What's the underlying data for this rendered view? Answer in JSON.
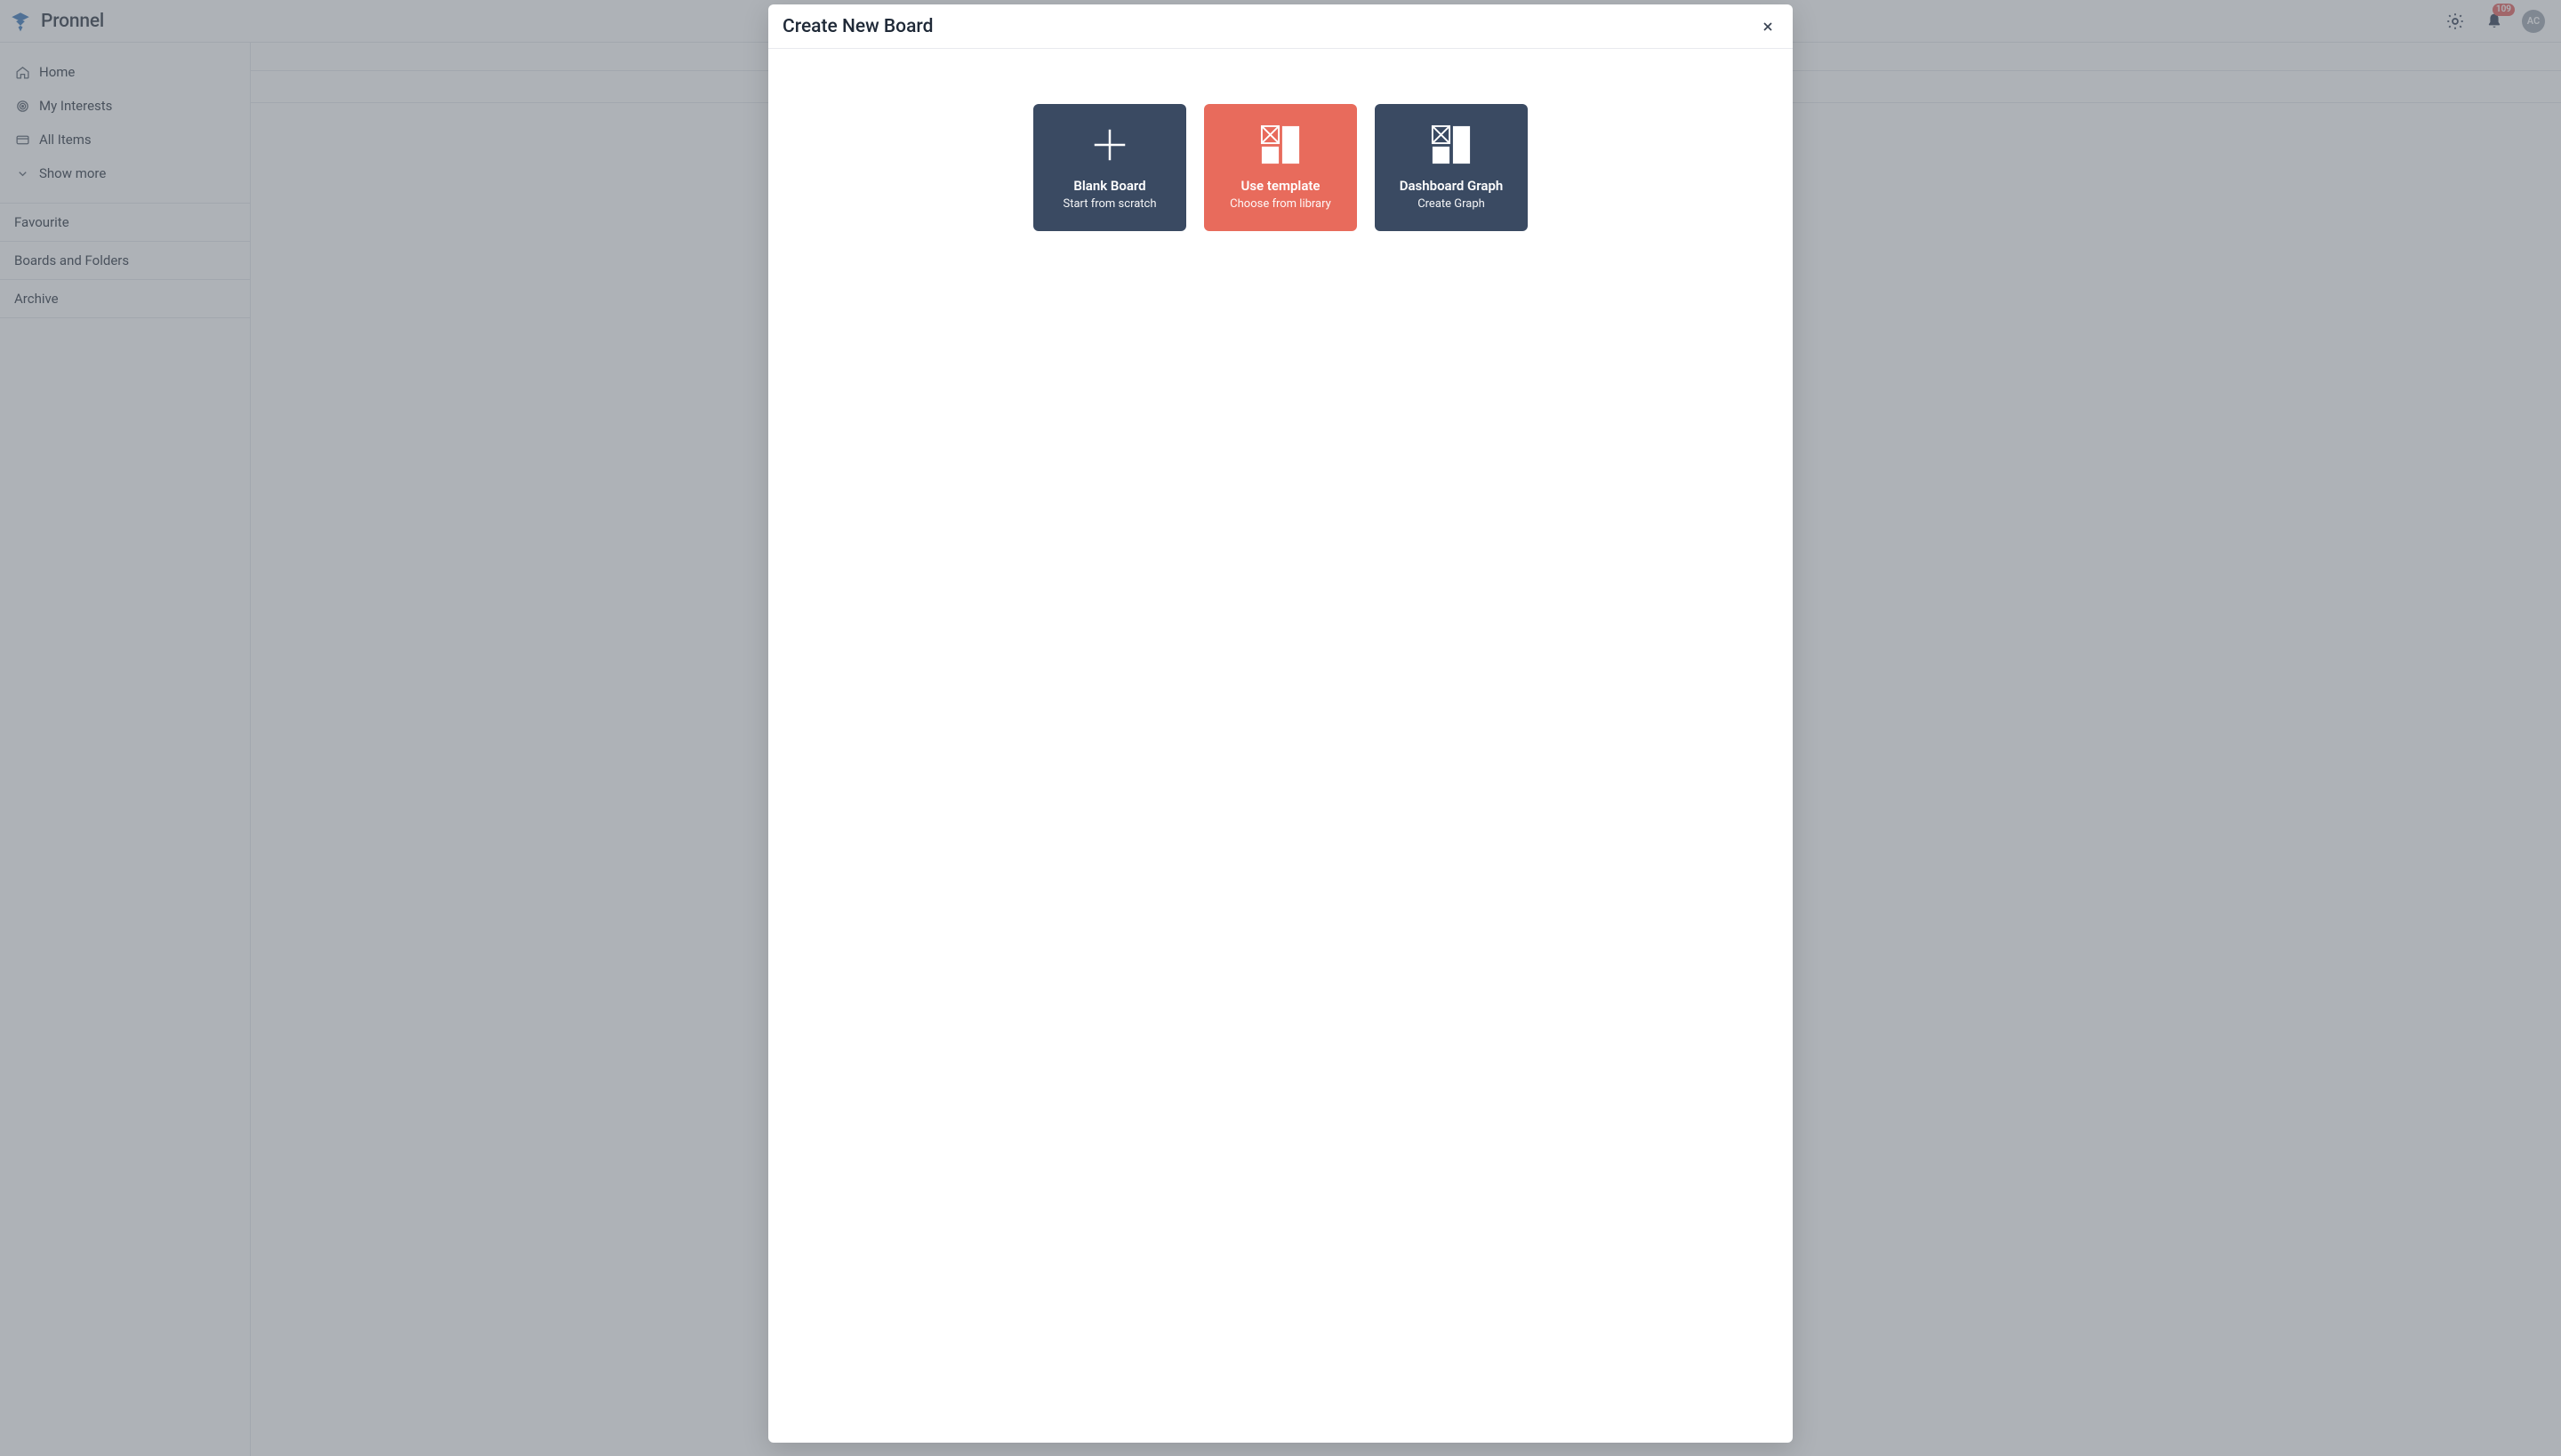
{
  "brand": {
    "name": "Pronnel"
  },
  "topbar": {
    "notification_count": "109",
    "avatar_initials": "AC"
  },
  "sidebar": {
    "nav": [
      {
        "label": "Home",
        "icon": "home-icon"
      },
      {
        "label": "My Interests",
        "icon": "target-icon"
      },
      {
        "label": "All Items",
        "icon": "card-icon"
      },
      {
        "label": "Show more",
        "icon": "chevron-down-icon"
      }
    ],
    "sections": [
      {
        "label": "Favourite"
      },
      {
        "label": "Boards and Folders"
      },
      {
        "label": "Archive"
      }
    ]
  },
  "modal": {
    "title": "Create New Board",
    "options": [
      {
        "title": "Blank Board",
        "subtitle": "Start from scratch",
        "variant": "dark",
        "icon": "plus-large-icon"
      },
      {
        "title": "Use template",
        "subtitle": "Choose from library",
        "variant": "accent",
        "icon": "template-grid-icon"
      },
      {
        "title": "Dashboard Graph",
        "subtitle": "Create Graph",
        "variant": "dark",
        "icon": "dashboard-grid-icon"
      }
    ]
  }
}
